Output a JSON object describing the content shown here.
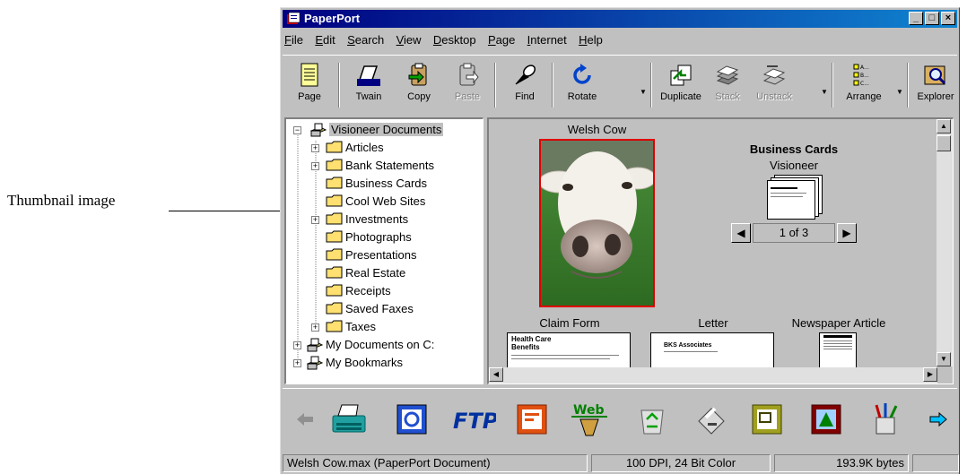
{
  "callout": {
    "label": "Thumbnail image"
  },
  "window": {
    "title": "PaperPort"
  },
  "menu": [
    "File",
    "Edit",
    "Search",
    "View",
    "Desktop",
    "Page",
    "Internet",
    "Help"
  ],
  "toolbar": {
    "page": "Page",
    "twain": "Twain",
    "copy": "Copy",
    "paste": "Paste",
    "find": "Find",
    "rotate": "Rotate",
    "duplicate": "Duplicate",
    "stack": "Stack",
    "unstack": "Unstack",
    "arrange": "Arrange",
    "explorer": "Explorer"
  },
  "tree": {
    "root": "Visioneer Documents",
    "folders": [
      "Articles",
      "Bank Statements",
      "Business Cards",
      "Cool Web Sites",
      "Investments",
      "Photographs",
      "Presentations",
      "Real Estate",
      "Receipts",
      "Saved Faxes",
      "Taxes"
    ],
    "other": [
      "My Documents on C:",
      "My Bookmarks"
    ]
  },
  "desktop": {
    "cow_title": "Welsh Cow",
    "stack_title": "Business Cards",
    "stack_subtitle": "Visioneer",
    "pager": "1 of 3",
    "claim_title": "Claim Form",
    "claim_heading_1": "Health Care",
    "claim_heading_2": "Benefits",
    "letter_title": "Letter",
    "letter_heading": "BKS Associates",
    "news_title": "Newspaper Article"
  },
  "status": {
    "file": "Welsh Cow.max (PaperPort Document)",
    "dpi": "100 DPI, 24 Bit Color",
    "size": "193.9K bytes"
  },
  "link_bar": {
    "web_label": "Web",
    "ftp_label": "FTP"
  }
}
